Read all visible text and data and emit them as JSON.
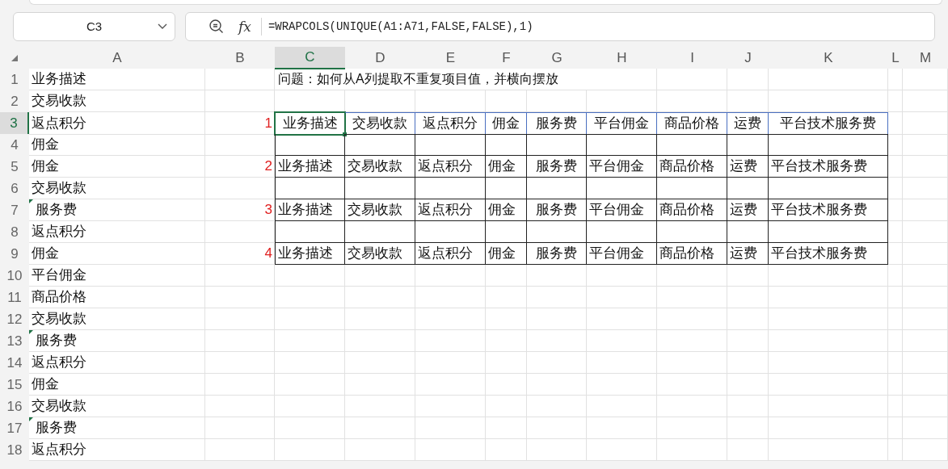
{
  "name_box": {
    "value": "C3"
  },
  "formula_bar": {
    "fx_label": "fx",
    "value": "=WRAPCOLS(UNIQUE(A1:A71,FALSE,FALSE),1)"
  },
  "columns": [
    {
      "label": "A",
      "selected": false
    },
    {
      "label": "B",
      "selected": false
    },
    {
      "label": "C",
      "selected": true
    },
    {
      "label": "D",
      "selected": false
    },
    {
      "label": "E",
      "selected": false
    },
    {
      "label": "F",
      "selected": false
    },
    {
      "label": "G",
      "selected": false
    },
    {
      "label": "H",
      "selected": false
    },
    {
      "label": "I",
      "selected": false
    },
    {
      "label": "J",
      "selected": false
    },
    {
      "label": "K",
      "selected": false
    },
    {
      "label": "L",
      "selected": false
    },
    {
      "label": "M",
      "selected": false
    }
  ],
  "rows": [
    {
      "number": "1",
      "selected": false,
      "a": {
        "text": "业务描述",
        "flagged": false
      }
    },
    {
      "number": "2",
      "selected": false,
      "a": {
        "text": "交易收款",
        "flagged": false
      }
    },
    {
      "number": "3",
      "selected": true,
      "a": {
        "text": "返点积分",
        "flagged": false
      }
    },
    {
      "number": "4",
      "selected": false,
      "a": {
        "text": "佣金",
        "flagged": false
      }
    },
    {
      "number": "5",
      "selected": false,
      "a": {
        "text": "佣金",
        "flagged": false
      }
    },
    {
      "number": "6",
      "selected": false,
      "a": {
        "text": "交易收款",
        "flagged": false
      }
    },
    {
      "number": "7",
      "selected": false,
      "a": {
        "text": "服务费",
        "flagged": true
      }
    },
    {
      "number": "8",
      "selected": false,
      "a": {
        "text": "返点积分",
        "flagged": false
      }
    },
    {
      "number": "9",
      "selected": false,
      "a": {
        "text": "佣金",
        "flagged": false
      }
    },
    {
      "number": "10",
      "selected": false,
      "a": {
        "text": "平台佣金",
        "flagged": false
      }
    },
    {
      "number": "11",
      "selected": false,
      "a": {
        "text": "商品价格",
        "flagged": false
      }
    },
    {
      "number": "12",
      "selected": false,
      "a": {
        "text": "交易收款",
        "flagged": false
      }
    },
    {
      "number": "13",
      "selected": false,
      "a": {
        "text": "服务费",
        "flagged": true
      }
    },
    {
      "number": "14",
      "selected": false,
      "a": {
        "text": "返点积分",
        "flagged": false
      }
    },
    {
      "number": "15",
      "selected": false,
      "a": {
        "text": "佣金",
        "flagged": false
      }
    },
    {
      "number": "16",
      "selected": false,
      "a": {
        "text": "交易收款",
        "flagged": false
      }
    },
    {
      "number": "17",
      "selected": false,
      "a": {
        "text": "服务费",
        "flagged": true
      }
    },
    {
      "number": "18",
      "selected": false,
      "a": {
        "text": "返点积分",
        "flagged": false
      }
    }
  ],
  "question": "问题：如何从A列提取不重复项目值，并横向摆放",
  "results": [
    {
      "marker": "1",
      "kind": "spill",
      "active": true,
      "values": [
        "业务描述",
        "交易收款",
        "返点积分",
        "佣金",
        "服务费",
        "平台佣金",
        "商品价格",
        "运费",
        "平台技术服务费"
      ]
    },
    {
      "marker": "2",
      "kind": "static",
      "active": false,
      "values": [
        "业务描述",
        "交易收款",
        "返点积分",
        "佣金",
        "服务费",
        "平台佣金",
        "商品价格",
        "运费",
        "平台技术服务费"
      ]
    },
    {
      "marker": "3",
      "kind": "static",
      "active": false,
      "values": [
        "业务描述",
        "交易收款",
        "返点积分",
        "佣金",
        "服务费",
        "平台佣金",
        "商品价格",
        "运费",
        "平台技术服务费"
      ]
    },
    {
      "marker": "4",
      "kind": "static",
      "active": false,
      "values": [
        "业务描述",
        "交易收款",
        "返点积分",
        "佣金",
        "服务费",
        "平台佣金",
        "商品价格",
        "运费",
        "平台技术服务费"
      ]
    }
  ]
}
